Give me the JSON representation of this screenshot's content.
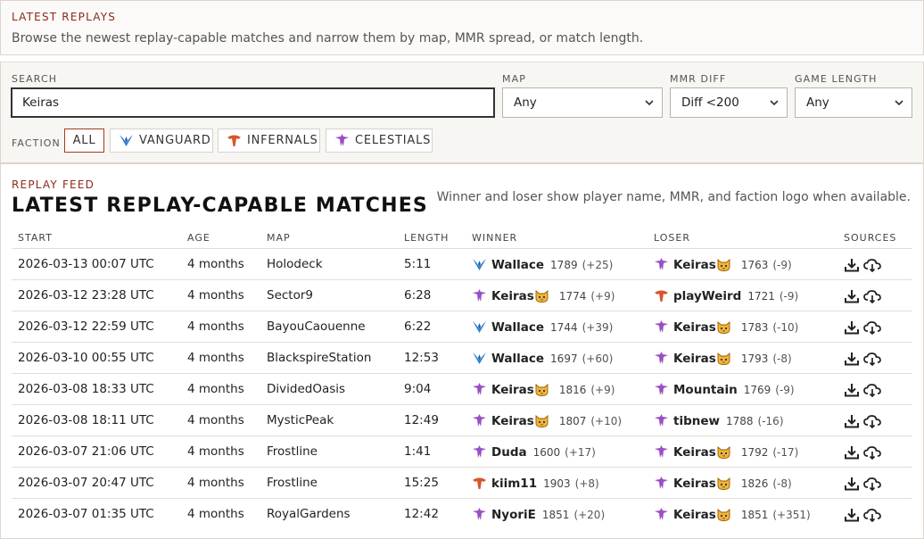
{
  "intro": {
    "kicker": "LATEST REPLAYS",
    "description": "Browse the newest replay-capable matches and narrow them by map, MMR spread, or match length."
  },
  "filters": {
    "search": {
      "label": "SEARCH",
      "value": "Keiras"
    },
    "map": {
      "label": "MAP",
      "value": "Any"
    },
    "mmr_diff": {
      "label": "MMR DIFF",
      "value": "Diff <200"
    },
    "game_length": {
      "label": "GAME LENGTH",
      "value": "Any"
    },
    "faction": {
      "label": "FACTION",
      "buttons": [
        {
          "label": "ALL",
          "icon": "none",
          "active": true
        },
        {
          "label": "VANGUARD",
          "icon": "vanguard-logo"
        },
        {
          "label": "INFERNALS",
          "icon": "infernals-logo"
        },
        {
          "label": "CELESTIALS",
          "icon": "celestials-logo"
        }
      ]
    }
  },
  "feed": {
    "kicker": "REPLAY FEED",
    "title": "LATEST REPLAY-CAPABLE MATCHES",
    "note": "Winner and loser show player name, MMR, and faction logo when available.",
    "columns": [
      "START",
      "AGE",
      "MAP",
      "LENGTH",
      "WINNER",
      "LOSER",
      "SOURCES"
    ],
    "rows": [
      {
        "start": "2026-03-13 00:07 UTC",
        "age": "4 months",
        "map": "Holodeck",
        "length": "5:11",
        "winner": {
          "faction": "vanguard",
          "name": "Wallace",
          "cat": false,
          "mmr": "1789",
          "delta": "(+25)"
        },
        "loser": {
          "faction": "celestials",
          "name": "Keiras",
          "cat": true,
          "mmr": "1763",
          "delta": "(-9)"
        }
      },
      {
        "start": "2026-03-12 23:28 UTC",
        "age": "4 months",
        "map": "Sector9",
        "length": "6:28",
        "winner": {
          "faction": "celestials",
          "name": "Keiras",
          "cat": true,
          "mmr": "1774",
          "delta": "(+9)"
        },
        "loser": {
          "faction": "infernals",
          "name": "playWeird",
          "cat": false,
          "mmr": "1721",
          "delta": "(-9)"
        }
      },
      {
        "start": "2026-03-12 22:59 UTC",
        "age": "4 months",
        "map": "BayouCaouenne",
        "length": "6:22",
        "winner": {
          "faction": "vanguard",
          "name": "Wallace",
          "cat": false,
          "mmr": "1744",
          "delta": "(+39)"
        },
        "loser": {
          "faction": "celestials",
          "name": "Keiras",
          "cat": true,
          "mmr": "1783",
          "delta": "(-10)"
        }
      },
      {
        "start": "2026-03-10 00:55 UTC",
        "age": "4 months",
        "map": "BlackspireStation",
        "length": "12:53",
        "winner": {
          "faction": "vanguard",
          "name": "Wallace",
          "cat": false,
          "mmr": "1697",
          "delta": "(+60)"
        },
        "loser": {
          "faction": "celestials",
          "name": "Keiras",
          "cat": true,
          "mmr": "1793",
          "delta": "(-8)"
        }
      },
      {
        "start": "2026-03-08 18:33 UTC",
        "age": "4 months",
        "map": "DividedOasis",
        "length": "9:04",
        "winner": {
          "faction": "celestials",
          "name": "Keiras",
          "cat": true,
          "mmr": "1816",
          "delta": "(+9)"
        },
        "loser": {
          "faction": "celestials",
          "name": "Mountain",
          "cat": false,
          "mmr": "1769",
          "delta": "(-9)"
        }
      },
      {
        "start": "2026-03-08 18:11 UTC",
        "age": "4 months",
        "map": "MysticPeak",
        "length": "12:49",
        "winner": {
          "faction": "celestials",
          "name": "Keiras",
          "cat": true,
          "mmr": "1807",
          "delta": "(+10)"
        },
        "loser": {
          "faction": "celestials",
          "name": "tibnew",
          "cat": false,
          "mmr": "1788",
          "delta": "(-16)"
        }
      },
      {
        "start": "2026-03-07 21:06 UTC",
        "age": "4 months",
        "map": "Frostline",
        "length": "1:41",
        "winner": {
          "faction": "celestials",
          "name": "Duda",
          "cat": false,
          "mmr": "1600",
          "delta": "(+17)"
        },
        "loser": {
          "faction": "celestials",
          "name": "Keiras",
          "cat": true,
          "mmr": "1792",
          "delta": "(-17)"
        }
      },
      {
        "start": "2026-03-07 20:47 UTC",
        "age": "4 months",
        "map": "Frostline",
        "length": "15:25",
        "winner": {
          "faction": "infernals",
          "name": "kiim11",
          "cat": false,
          "mmr": "1903",
          "delta": "(+8)"
        },
        "loser": {
          "faction": "celestials",
          "name": "Keiras",
          "cat": true,
          "mmr": "1826",
          "delta": "(-8)"
        }
      },
      {
        "start": "2026-03-07 01:35 UTC",
        "age": "4 months",
        "map": "RoyalGardens",
        "length": "12:42",
        "winner": {
          "faction": "celestials",
          "name": "NyoriE",
          "cat": false,
          "mmr": "1851",
          "delta": "(+20)"
        },
        "loser": {
          "faction": "celestials",
          "name": "Keiras",
          "cat": true,
          "mmr": "1851",
          "delta": "(+351)"
        }
      }
    ]
  },
  "colors": {
    "accent": "#8b2a1a",
    "vanguard": "#2f7fd0",
    "infernals": "#d9542a",
    "celestials": "#9b4fc4",
    "cat": "#f2b53a"
  }
}
